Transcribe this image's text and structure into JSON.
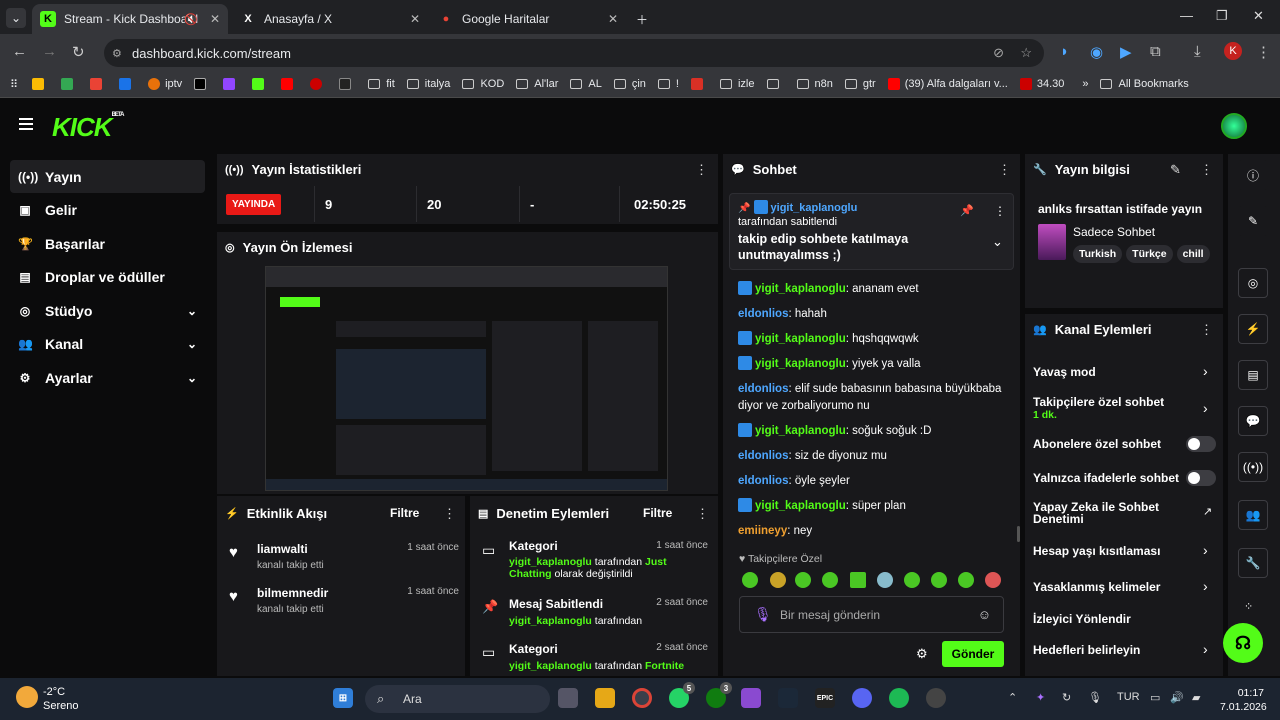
{
  "browser": {
    "tabs": [
      {
        "title": "Stream - Kick Dashboard"
      },
      {
        "title": "Anasayfa / X"
      },
      {
        "title": "Google Haritalar"
      }
    ],
    "url": "dashboard.kick.com/stream",
    "profile_initial": "K",
    "bookmarks": [
      "iptv",
      "fit",
      "italya",
      "KOD",
      "Al'lar",
      "AL",
      "çin",
      "!",
      "izle",
      "n8n",
      "gtr",
      "(39) Alfa dalgaları v...",
      "34.30",
      "All Bookmarks"
    ]
  },
  "app": {
    "logo": "KICK",
    "logo_tag": "BETA",
    "nav": [
      {
        "label": "Yayın",
        "icon": "broadcast-icon"
      },
      {
        "label": "Gelir",
        "icon": "chart-icon"
      },
      {
        "label": "Başarılar",
        "icon": "trophy-icon"
      },
      {
        "label": "Droplar ve ödüller",
        "icon": "gift-icon"
      },
      {
        "label": "Stüdyo",
        "icon": "camera-icon"
      },
      {
        "label": "Kanal",
        "icon": "users-icon"
      },
      {
        "label": "Ayarlar",
        "icon": "gear-icon"
      }
    ]
  },
  "stats": {
    "title": "Yayın İstatistikleri",
    "live_label": "YAYINDA",
    "viewers": "9",
    "followers": "20",
    "subs": "-",
    "duration": "02:50:25"
  },
  "preview": {
    "title": "Yayın Ön İzlemesi"
  },
  "activity": {
    "title": "Etkinlik Akışı",
    "filter": "Filtre",
    "items": [
      {
        "user": "liamwalti",
        "text": "kanalı takip etti",
        "time": "1 saat önce"
      },
      {
        "user": "bilmemnedir",
        "text": "kanalı takip etti",
        "time": "1 saat önce"
      }
    ]
  },
  "moderation": {
    "title": "Denetim Eylemleri",
    "filter": "Filtre",
    "items": [
      {
        "title": "Kategori",
        "user": "yigit_kaplanoglu",
        "text1": "tarafından",
        "highlight": "Just Chatting",
        "text2": "olarak değiştirildi",
        "time": "1 saat önce"
      },
      {
        "title": "Mesaj Sabitlendi",
        "user": "yigit_kaplanoglu",
        "text1": "tarafından",
        "time": "2 saat önce"
      },
      {
        "title": "Kategori",
        "user": "yigit_kaplanoglu",
        "text1": "tarafından",
        "highlight": "Fortnite",
        "time": "2 saat önce"
      }
    ]
  },
  "chat": {
    "title": "Sohbet",
    "pinned_user": "yigit_kaplanoglu",
    "pinned_by": "tarafından sabitlendi",
    "pinned_text": "takip edip sohbete katılmaya unutmayalımss ;)",
    "messages": [
      {
        "user": "yigit_kaplanoglu",
        "text": "ananam evet",
        "color": "green"
      },
      {
        "user": "eldonlios",
        "text": "hahah",
        "color": "blue"
      },
      {
        "user": "yigit_kaplanoglu",
        "text": "hqshqqwqwk",
        "color": "green"
      },
      {
        "user": "yigit_kaplanoglu",
        "text": "yiyek ya valla",
        "color": "green"
      },
      {
        "user": "eldonlios",
        "text": "elif sude babasının babasına büyükbaba diyor ve zorbaliyorumo nu",
        "color": "blue"
      },
      {
        "user": "yigit_kaplanoglu",
        "text": "soğuk soğuk :D",
        "color": "green"
      },
      {
        "user": "eldonlios",
        "text": "siz de diyonuz mu",
        "color": "blue"
      },
      {
        "user": "eldonlios",
        "text": "öyle şeyler",
        "color": "blue"
      },
      {
        "user": "yigit_kaplanoglu",
        "text": "süper plan",
        "color": "green"
      },
      {
        "user": "emiineyy",
        "text": "ney",
        "color": "orange"
      }
    ],
    "followers_only": "Takipçilere Özel",
    "placeholder": "Bir mesaj gönderin",
    "send": "Gönder"
  },
  "stream_info": {
    "title": "Yayın bilgisi",
    "stream_title": "anlıks fırsattan istifade yayın",
    "category": "Sadece Sohbet",
    "tags": [
      "Turkish",
      "Türkçe",
      "chill"
    ]
  },
  "channel_actions": {
    "title": "Kanal Eylemleri",
    "items": [
      {
        "label": "Yavaş mod"
      },
      {
        "label": "Takipçilere özel sohbet",
        "sub": "1 dk."
      },
      {
        "label": "Abonelere özel sohbet"
      },
      {
        "label": "Yalnızca ifadelerle sohbet"
      },
      {
        "label": "Yapay Zeka ile Sohbet Denetimi"
      },
      {
        "label": "Hesap yaşı kısıtlaması"
      },
      {
        "label": "Yasaklanmış kelimeler"
      },
      {
        "label": "İzleyici Yönlendir"
      },
      {
        "label": "Hedefleri belirleyin"
      }
    ]
  },
  "taskbar": {
    "weather_temp": "-2°C",
    "weather_text": "Sereno",
    "search": "Ara",
    "lang": "TUR",
    "time": "01:17",
    "date": "7.01.2026",
    "badge_wa": "5",
    "badge_xbox": "3"
  },
  "colors": {
    "accent": "#53fc18",
    "live": "#e91916",
    "panel": "#18181b"
  }
}
